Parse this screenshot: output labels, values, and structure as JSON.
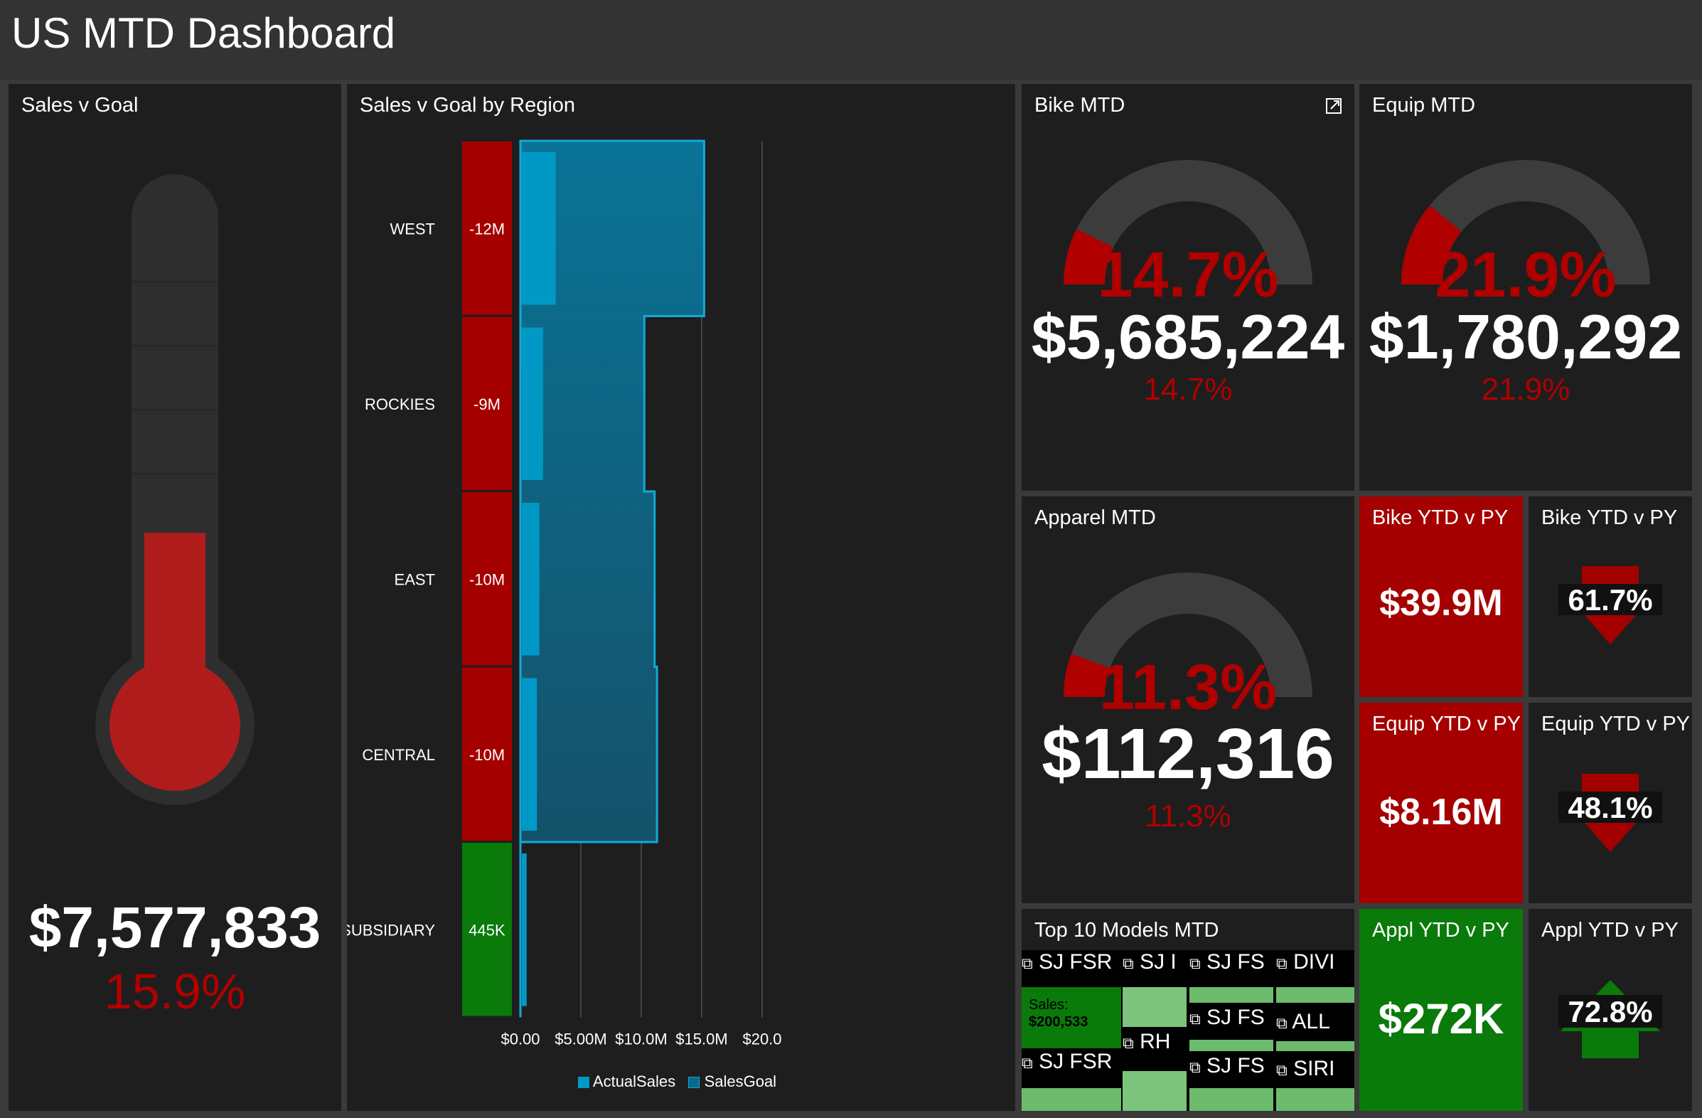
{
  "header": {
    "title": "US MTD Dashboard"
  },
  "sales_v_goal": {
    "title": "Sales v Goal",
    "value": "$7,577,833",
    "pct": "15.9%",
    "fill_fraction": 0.159
  },
  "region": {
    "title": "Sales v Goal by Region",
    "rows": [
      {
        "label": "WEST",
        "delta": "-12M",
        "status": "red"
      },
      {
        "label": "ROCKIES",
        "delta": "-9M",
        "status": "red"
      },
      {
        "label": "EAST",
        "delta": "-10M",
        "status": "red"
      },
      {
        "label": "CENTRAL",
        "delta": "-10M",
        "status": "red"
      },
      {
        "label": "SUBSIDIARY",
        "delta": "445K",
        "status": "green"
      }
    ],
    "x_ticks": [
      "$0.00",
      "$5.00M",
      "$10.0M",
      "$15.0M",
      "$20.0"
    ],
    "legend": [
      {
        "label": "ActualSales"
      },
      {
        "label": "SalesGoal"
      }
    ]
  },
  "chart_data": {
    "type": "bar",
    "categories": [
      "WEST",
      "ROCKIES",
      "EAST",
      "CENTRAL",
      "SUBSIDIARY"
    ],
    "series": [
      {
        "name": "ActualSales",
        "values": [
          2.8,
          1.75,
          1.45,
          1.25,
          0.4
        ]
      },
      {
        "name": "SalesGoal",
        "values": [
          15.2,
          10.25,
          11.1,
          11.3,
          0.0
        ]
      }
    ],
    "xlim": [
      0,
      20
    ],
    "colors": {
      "ActualSales": "#0099c6",
      "SalesGoal": "#0b6a88"
    }
  },
  "bike_mtd": {
    "title": "Bike MTD",
    "pct": "14.7%",
    "value": "$5,685,224",
    "sub": "14.7%",
    "fraction": 0.147
  },
  "equip_mtd": {
    "title": "Equip MTD",
    "pct": "21.9%",
    "value": "$1,780,292",
    "sub": "21.9%",
    "fraction": 0.219
  },
  "apparel_mtd": {
    "title": "Apparel MTD",
    "pct": "11.3%",
    "value": "$112,316",
    "sub": "11.3%",
    "fraction": 0.113
  },
  "bike_ytd_val": {
    "title": "Bike YTD v PY",
    "value": "$39.9M"
  },
  "bike_ytd_pct": {
    "title": "Bike YTD v PY",
    "value": "61.7%",
    "direction": "down"
  },
  "equip_ytd_val": {
    "title": "Equip YTD v PY",
    "value": "$8.16M"
  },
  "equip_ytd_pct": {
    "title": "Equip YTD v PY",
    "value": "48.1%",
    "direction": "down"
  },
  "appl_ytd_val": {
    "title": "Appl YTD v PY",
    "value": "$272K"
  },
  "appl_ytd_pct": {
    "title": "Appl YTD v PY",
    "value": "72.8%",
    "direction": "up"
  },
  "top10": {
    "title": "Top 10 Models MTD",
    "cells": [
      {
        "label": "SJ FSR",
        "tooltip_label": "Sales:",
        "tooltip_value": "$200,533"
      },
      {
        "label": "SJ I"
      },
      {
        "label": "SJ FS"
      },
      {
        "label": "DIVI"
      },
      {
        "label": "SJ FS"
      },
      {
        "label": "ALL"
      },
      {
        "label": "RH"
      },
      {
        "label": "SJ FSR"
      },
      {
        "label": "SJ FS"
      },
      {
        "label": "SIRI"
      }
    ]
  },
  "colors": {
    "red": "#a50000",
    "green": "#0a7a0a",
    "tile": "#1e1e1e",
    "gauge_track": "#3c3c3c"
  }
}
